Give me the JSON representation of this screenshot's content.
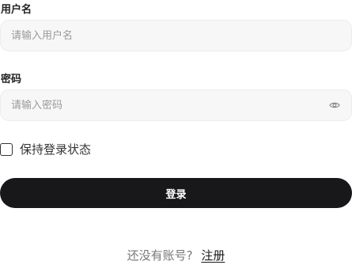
{
  "form": {
    "username_label": "用户名",
    "username_placeholder": "请输入用户名",
    "password_label": "密码",
    "password_placeholder": "请输入密码",
    "password_toggle_icon": "eye-icon",
    "remember_label": "保持登录状态",
    "remember_checked": false,
    "login_label": "登录",
    "signup_prompt": "还没有账号?",
    "signup_link": "注册"
  },
  "colors": {
    "button_bg": "#18181b",
    "input_bg": "#f7f7f7",
    "placeholder": "#9a9a9a"
  }
}
